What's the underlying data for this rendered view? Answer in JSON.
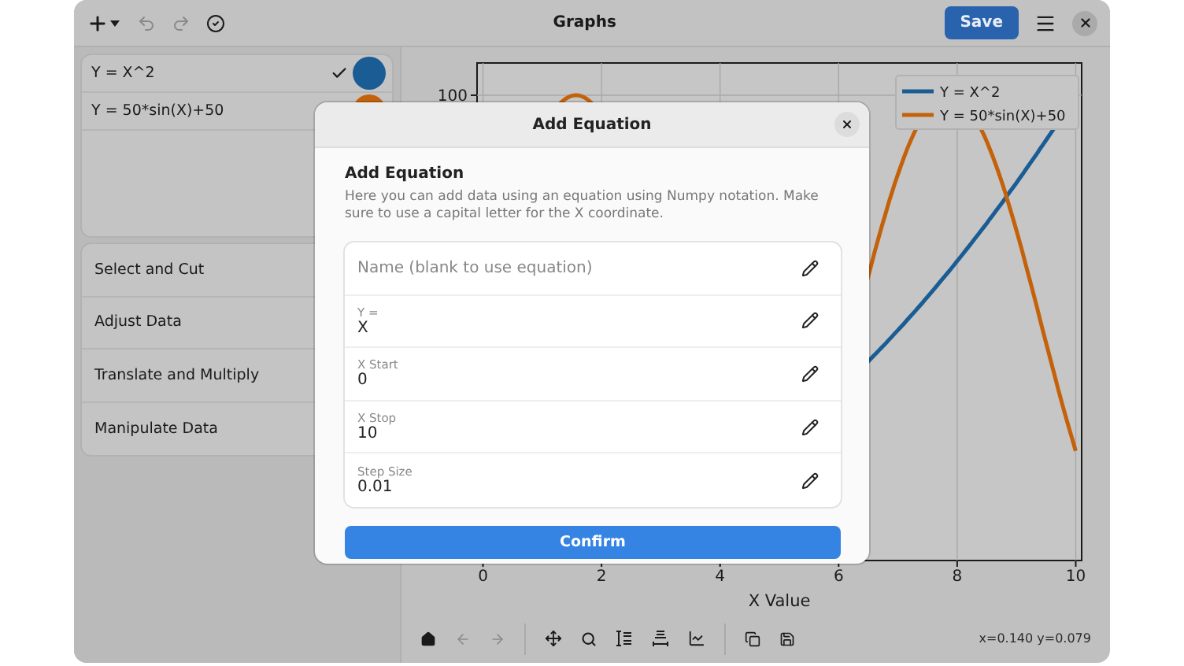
{
  "window": {
    "title": "Graphs",
    "save_button": "Save"
  },
  "items": [
    {
      "name": "Y = X^2",
      "checked": true,
      "color": "#1a5c94"
    },
    {
      "name": "Y = 50*sin(X)+50",
      "color": "#c4620b"
    }
  ],
  "tools": [
    "Select and Cut",
    "Adjust Data",
    "Translate and Multiply",
    "Manipulate Data"
  ],
  "chart": {
    "xlabel": "X Value",
    "x_ticks": [
      "0",
      "2",
      "4",
      "6",
      "8",
      "10"
    ],
    "y_ticks": [
      "100"
    ],
    "legend": [
      {
        "name": "Y = X^2",
        "color": "#1a5c94"
      },
      {
        "name": "Y = 50*sin(X)+50",
        "color": "#c4620b"
      }
    ]
  },
  "toolbar": {
    "coordinates": "x=0.140 y=0.079"
  },
  "dialog": {
    "title": "Add Equation",
    "heading": "Add Equation",
    "description": " Here you can add data using an equation using Numpy notation. Make sure to use a capital letter for the X coordinate.",
    "confirm": "Confirm",
    "fields": [
      {
        "placeholder": "Name (blank to use equation)"
      },
      {
        "label": "Y =",
        "value": "X"
      },
      {
        "label": "X Start",
        "value": "0"
      },
      {
        "label": "X Stop",
        "value": "10"
      },
      {
        "label": "Step Size",
        "value": "0.01"
      }
    ]
  }
}
